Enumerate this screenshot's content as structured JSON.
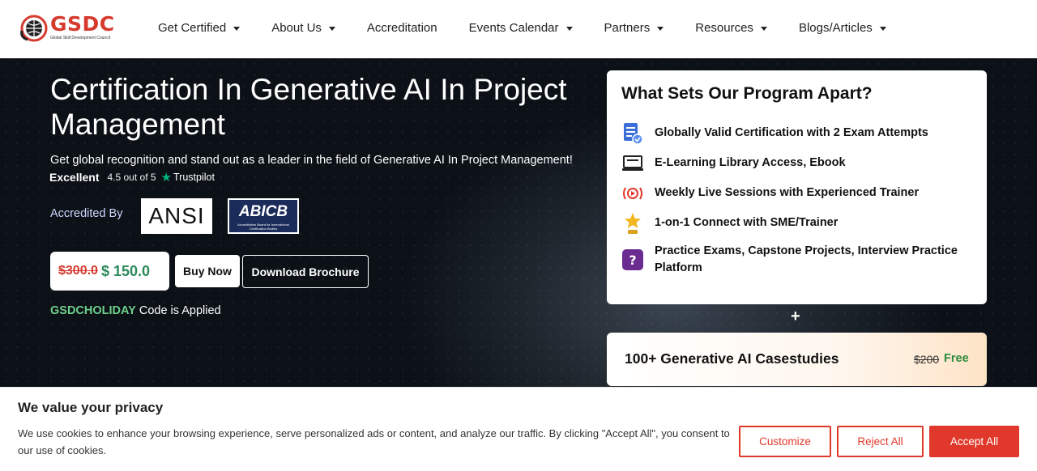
{
  "brand": {
    "name": "GSDC",
    "tagline": "Global Skill Development Council",
    "accent": "#d63a2f"
  },
  "nav": {
    "items": [
      {
        "label": "Get Certified",
        "dropdown": true
      },
      {
        "label": "About Us",
        "dropdown": true
      },
      {
        "label": "Accreditation",
        "dropdown": false
      },
      {
        "label": "Events Calendar",
        "dropdown": true
      },
      {
        "label": "Partners",
        "dropdown": true
      },
      {
        "label": "Resources",
        "dropdown": true
      },
      {
        "label": "Blogs/Articles",
        "dropdown": true
      }
    ]
  },
  "hero": {
    "title": "Certification In Generative AI In Project Management",
    "subtitle": "Get global recognition and stand out as a leader in the field of Generative AI In Project Management!",
    "rating": {
      "label": "Excellent",
      "score": "4.5 out of 5",
      "provider": "Trustpilot"
    },
    "accredited_label": "Accredited By",
    "accreditors": {
      "ansi": "ANSI",
      "abicb": "ABICB",
      "abicb_sub": "Accreditation Board for International Certification Bodies"
    },
    "price": {
      "old": "$300.0",
      "new": "$ 150.0"
    },
    "buy_label": "Buy Now",
    "brochure_label": "Download Brochure",
    "coupon_code": "GSDCHOLIDAY",
    "coupon_text": "Code is Applied"
  },
  "program_card": {
    "title": "What Sets Our Program Apart?",
    "features": [
      {
        "text": "Globally Valid Certification with 2 Exam Attempts",
        "icon": "certificate-icon"
      },
      {
        "text": "E-Learning Library Access, Ebook",
        "icon": "laptop-icon"
      },
      {
        "text": "Weekly Live Sessions with Experienced Trainer",
        "icon": "live-broadcast-icon"
      },
      {
        "text": "1-on-1 Connect with SME/Trainer",
        "icon": "star-person-icon"
      },
      {
        "text": "Practice Exams, Capstone Projects, Interview Practice Platform",
        "icon": "question-icon"
      }
    ],
    "plus": "+"
  },
  "casestudies": {
    "title": "100+ Generative AI Casestudies",
    "old_price": "$200",
    "new_price": "Free"
  },
  "cookie": {
    "title": "We value your privacy",
    "text": "We use cookies to enhance your browsing experience, serve personalized ads or content, and analyze our traffic. By clicking \"Accept All\", you consent to our use of cookies.",
    "customize": "Customize",
    "reject": "Reject All",
    "accept": "Accept All",
    "accent": "#e0392b"
  }
}
